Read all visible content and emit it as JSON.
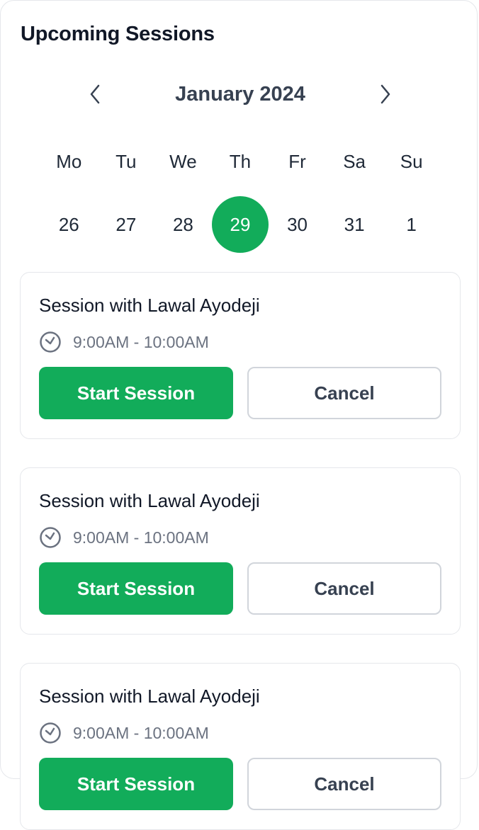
{
  "header": {
    "title": "Upcoming Sessions"
  },
  "calendar": {
    "month_label": "January 2024",
    "prev_icon": "chevron-left-icon",
    "next_icon": "chevron-right-icon",
    "weekdays": [
      "Mo",
      "Tu",
      "We",
      "Th",
      "Fr",
      "Sa",
      "Su"
    ],
    "days": [
      "26",
      "27",
      "28",
      "29",
      "30",
      "31",
      "1"
    ],
    "selected_day": "29"
  },
  "sessions": [
    {
      "title": "Session with Lawal Ayodeji",
      "time": "9:00AM - 10:00AM",
      "start_label": "Start Session",
      "cancel_label": "Cancel"
    },
    {
      "title": "Session with Lawal Ayodeji",
      "time": "9:00AM - 10:00AM",
      "start_label": "Start Session",
      "cancel_label": "Cancel"
    },
    {
      "title": "Session with Lawal Ayodeji",
      "time": "9:00AM - 10:00AM",
      "start_label": "Start Session",
      "cancel_label": "Cancel"
    }
  ],
  "colors": {
    "accent": "#12ac5a",
    "title_text": "#111827",
    "muted_text": "#6b7280",
    "border": "#e5e7eb"
  }
}
